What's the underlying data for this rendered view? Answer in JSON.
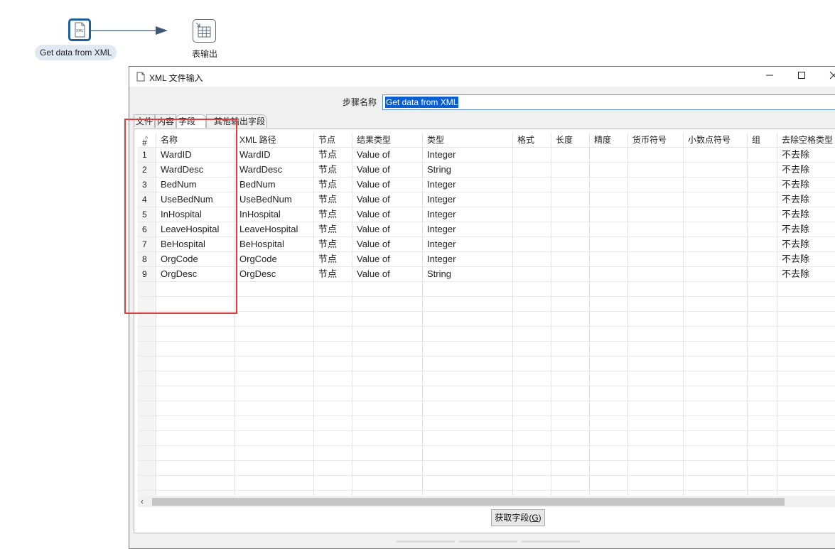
{
  "canvas": {
    "steps": [
      {
        "label": "Get data from XML",
        "icon": "xml-file-icon"
      },
      {
        "label": "表输出",
        "icon": "table-output-icon"
      }
    ]
  },
  "dialog": {
    "title": "XML 文件输入",
    "step_name_label": "步骤名称",
    "step_name_value": "Get data from XML",
    "tabs": [
      "文件",
      "内容",
      "字段",
      "其他输出字段"
    ],
    "active_tab": "字段",
    "table": {
      "columns": [
        "#",
        "名称",
        "XML 路径",
        "节点",
        "结果类型",
        "类型",
        "格式",
        "长度",
        "精度",
        "货币符号",
        "小数点符号",
        "组",
        "去除空格类型"
      ],
      "rows": [
        {
          "num": "1",
          "name": "WardID",
          "path": "WardID",
          "node": "节点",
          "result": "Value of",
          "type": "Integer",
          "trim": "不去除"
        },
        {
          "num": "2",
          "name": "WardDesc",
          "path": "WardDesc",
          "node": "节点",
          "result": "Value of",
          "type": "String",
          "trim": "不去除"
        },
        {
          "num": "3",
          "name": "BedNum",
          "path": "BedNum",
          "node": "节点",
          "result": "Value of",
          "type": "Integer",
          "trim": "不去除"
        },
        {
          "num": "4",
          "name": "UseBedNum",
          "path": "UseBedNum",
          "node": "节点",
          "result": "Value of",
          "type": "Integer",
          "trim": "不去除"
        },
        {
          "num": "5",
          "name": "InHospital",
          "path": "InHospital",
          "node": "节点",
          "result": "Value of",
          "type": "Integer",
          "trim": "不去除"
        },
        {
          "num": "6",
          "name": "LeaveHospital",
          "path": "LeaveHospital",
          "node": "节点",
          "result": "Value of",
          "type": "Integer",
          "trim": "不去除"
        },
        {
          "num": "7",
          "name": "BeHospital",
          "path": "BeHospital",
          "node": "节点",
          "result": "Value of",
          "type": "Integer",
          "trim": "不去除"
        },
        {
          "num": "8",
          "name": "OrgCode",
          "path": "OrgCode",
          "node": "节点",
          "result": "Value of",
          "type": "Integer",
          "trim": "不去除"
        },
        {
          "num": "9",
          "name": "OrgDesc",
          "path": "OrgDesc",
          "node": "节点",
          "result": "Value of",
          "type": "String",
          "trim": "不去除"
        }
      ]
    },
    "get_fields_button": "获取字段",
    "get_fields_mnemonic": "G"
  },
  "colors": {
    "accent": "#0a5fd0",
    "highlight": "#e03c3c",
    "step_border": "#1f5f9c"
  }
}
